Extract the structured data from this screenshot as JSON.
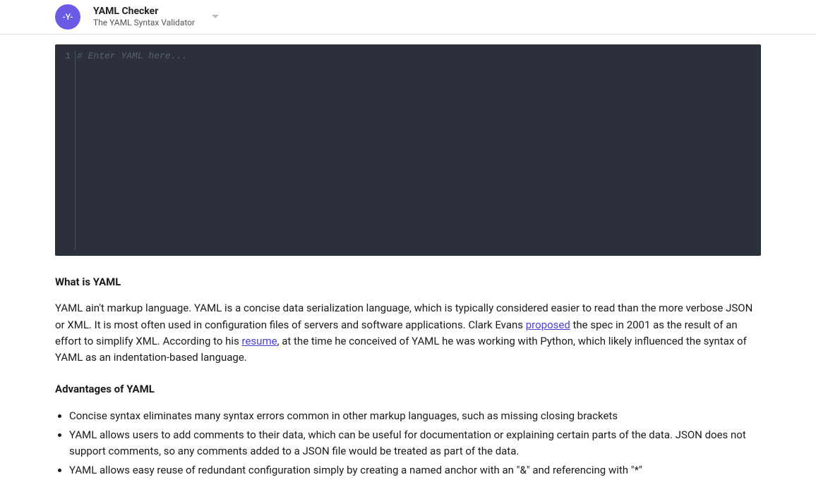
{
  "header": {
    "logo_text": "-Y-",
    "title": "YAML Checker",
    "subtitle": "The YAML Syntax Validator"
  },
  "editor": {
    "line_number": "1",
    "placeholder": "# Enter YAML here..."
  },
  "content": {
    "heading1": "What is YAML",
    "para1_part1": "YAML ain't markup language. YAML is a concise data serialization language, which is typically considered easier to read than the more verbose JSON or XML. It is most often used in configuration files of servers and software applications. Clark Evans ",
    "link1": "proposed",
    "para1_part2": " the spec in 2001 as the result of an effort to simplify XML. According to his ",
    "link2": "resume",
    "para1_part3": ", at the time he conceived of YAML he was working with Python, which likely influenced the syntax of YAML as an indentation-based language.",
    "heading2": "Advantages of YAML",
    "advantages": [
      "Concise syntax eliminates many syntax errors common in other markup languages, such as missing closing brackets",
      "YAML allows users to add comments to their data, which can be useful for documentation or explaining certain parts of the data. JSON does not support comments, so any comments added to a JSON file would be treated as part of the data.",
      "YAML allows easy reuse of redundant configuration simply by creating a named anchor with an \"&\" and referencing with \"*\""
    ]
  }
}
